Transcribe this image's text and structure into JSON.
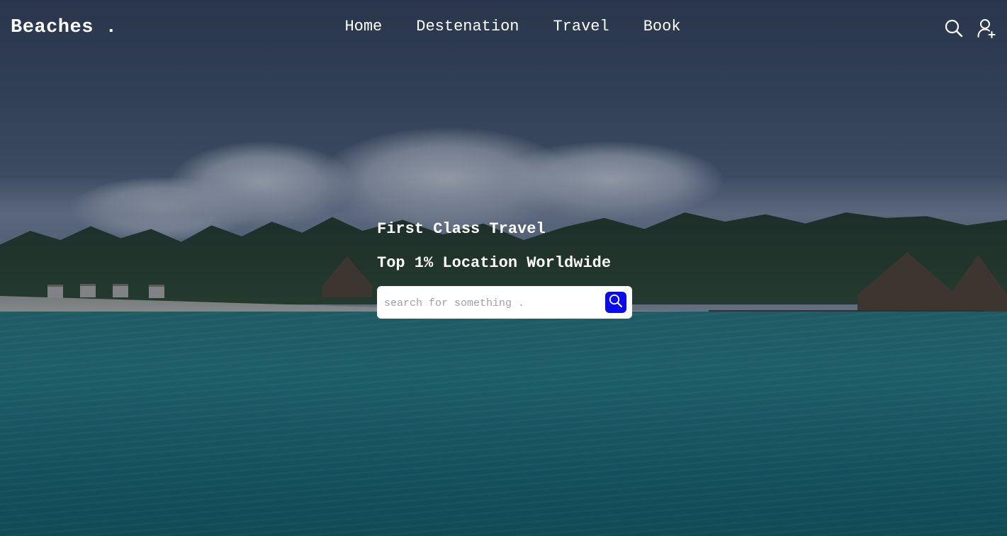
{
  "brand": {
    "logo": "Beaches ."
  },
  "nav": {
    "items": [
      {
        "label": "Home"
      },
      {
        "label": "Destenation"
      },
      {
        "label": "Travel"
      },
      {
        "label": "Book"
      }
    ]
  },
  "header_actions": {
    "icons": [
      "search-icon",
      "add-user-icon"
    ]
  },
  "hero": {
    "headline": "First Class Travel",
    "subheadline": "Top 1% Location Worldwide",
    "search": {
      "placeholder": "search for something .",
      "value": "",
      "button_icon": "search-icon"
    }
  },
  "colors": {
    "accent": "#0a0aee",
    "text": "#ffffff",
    "search_bg": "#ffffff"
  }
}
